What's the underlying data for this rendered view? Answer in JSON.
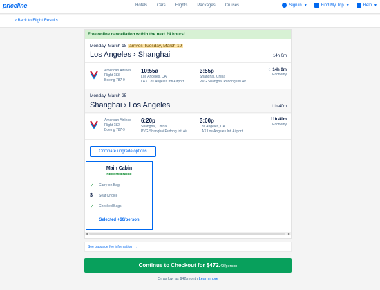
{
  "brand": {
    "logo": "priceline",
    "primary_color": "#0068ef",
    "success_color": "#08a05c"
  },
  "nav": {
    "items": [
      "Hotels",
      "Cars",
      "Flights",
      "Packages",
      "Cruises"
    ]
  },
  "account": {
    "sign_in": "Sign in",
    "find_trip": "Find My Trip",
    "help": "Help"
  },
  "back_link": "Back to Flight Results",
  "promo": "Free online cancellation within the next 24 hours!",
  "outbound": {
    "date": "Monday, March 18",
    "arrives": "arrives Tuesday, March 19",
    "route": "Los Angeles › Shanghai",
    "total_duration": "14h 0m",
    "segment": {
      "airline": "American Airlines",
      "flight": "Flight 183",
      "aircraft": "Boeing 787-9",
      "dep_time": "10:55a",
      "dep_city": "Los Angeles, CA",
      "dep_airport": "LAX Los Angeles Intl Airport",
      "arr_time": "3:55p",
      "arr_city": "Shanghai, China",
      "arr_airport": "PVG Shanghai Pudong Intl Air...",
      "duration": "14h 0m",
      "cabin": "Economy"
    }
  },
  "return": {
    "date": "Monday, March 25",
    "route": "Shanghai › Los Angeles",
    "total_duration": "11h 40m",
    "segment": {
      "airline": "American Airlines",
      "flight": "Flight 182",
      "aircraft": "Boeing 787-9",
      "dep_time": "6:20p",
      "dep_city": "Shanghai, China",
      "dep_airport": "PVG Shanghai Pudong Intl Air...",
      "arr_time": "3:00p",
      "arr_city": "Los Angeles, CA",
      "arr_airport": "LAX Los Angeles Intl Airport",
      "duration": "11h 40m",
      "cabin": "Economy"
    }
  },
  "compare_upgrade": "Compare upgrade options",
  "cabin_card": {
    "name": "Main Cabin",
    "badge": "RECOMMENDED",
    "features": [
      "Carry-on Bag",
      "Seat Choice",
      "Checked Bags"
    ],
    "selected": "Selected +$0/person"
  },
  "baggage_link": "See baggage fee information",
  "checkout": {
    "label": "Continue to Checkout for $472.",
    "cents": "43/person"
  },
  "affirm": {
    "text": "Or as low as $42/month",
    "link": "Learn more"
  }
}
